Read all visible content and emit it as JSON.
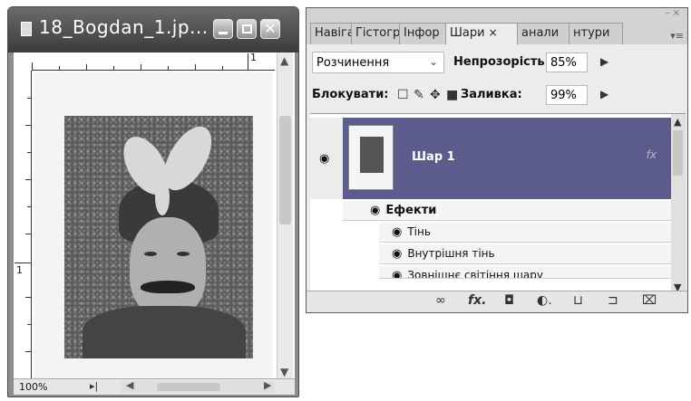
{
  "document": {
    "title": "18_Bogdan_1.jp...",
    "zoom": "100%",
    "ruler_top_mark": "1",
    "ruler_left_mark": "1"
  },
  "layers_panel": {
    "tabs": [
      {
        "label": "Навіга"
      },
      {
        "label": "Гістогр"
      },
      {
        "label": "Інфор"
      },
      {
        "label": "Шари",
        "close": "×"
      },
      {
        "label": "анали"
      },
      {
        "label": "нтури"
      }
    ],
    "blend_mode": "Розчинення",
    "opacity_label": "Непрозорість:",
    "opacity_value": "85%",
    "lock_label": "Блокувати:",
    "fill_label": "Заливка:",
    "fill_value": "99%",
    "layer": {
      "name": "Шар 1",
      "fx": "fx"
    },
    "effects": {
      "header": "Ефекти",
      "items": [
        "Тінь",
        "Внутрішня тінь",
        "Зовнішнє світіння шару"
      ]
    }
  },
  "icons": {
    "eye": "eye-icon",
    "link": "link-icon",
    "fx": "fx-icon",
    "mask": "mask-icon",
    "adjustment": "adjustment-icon",
    "group": "folder-icon",
    "new_layer": "new-layer-icon",
    "trash": "trash-icon"
  }
}
